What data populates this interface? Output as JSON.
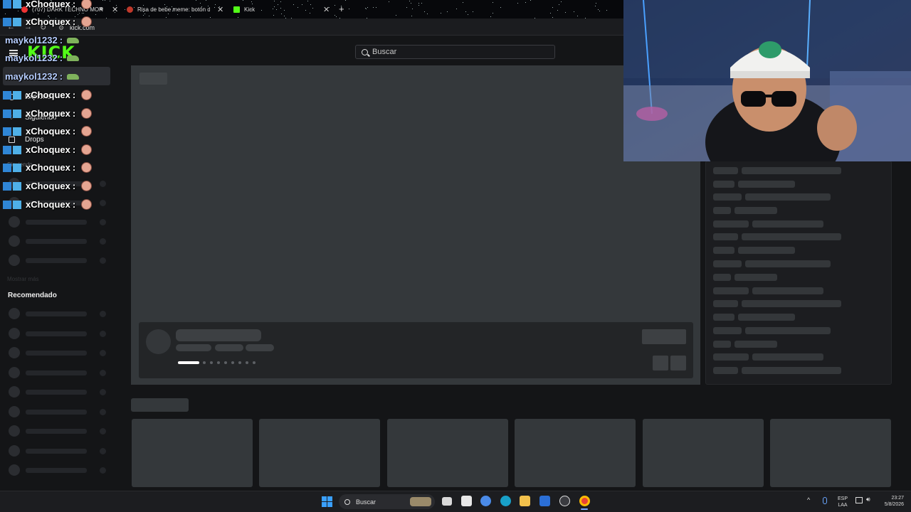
{
  "browser": {
    "tabs": [
      {
        "label": "(707) DARK TECHNO MORA",
        "active": false
      },
      {
        "label": "Risa de bebe meme: botón de",
        "active": false
      },
      {
        "label": "Kick",
        "active": true
      }
    ],
    "new_tab_symbol": "+",
    "close_symbol": "✕",
    "url": "kick.com"
  },
  "kick": {
    "logo_text": "KICK",
    "search_placeholder": "Buscar",
    "brand_color": "#53fc18",
    "sidebar": {
      "nav": [
        {
          "label": "Explorar",
          "icon": "compass-icon"
        },
        {
          "label": "Siguiendo",
          "icon": "heart-icon"
        },
        {
          "label": "Drops",
          "icon": "gift-icon"
        }
      ],
      "following_heading": "Siguiendo",
      "show_more": "Mostrar más",
      "recommended_heading": "Recomendado"
    }
  },
  "stream_overlay": {
    "chat_lines": [
      {
        "user": "xChoquex",
        "sep": ":",
        "emote": "head-emote"
      },
      {
        "user": "xChoquex",
        "sep": ":",
        "emote": "head-emote"
      },
      {
        "user": "maykol1232",
        "sep": ":",
        "emote": "croc-emote"
      },
      {
        "user": "maykol1232",
        "sep": ":",
        "emote": "croc-emote"
      },
      {
        "user": "maykol1232",
        "sep": ":",
        "emote": "croc-emote"
      },
      {
        "user": "xChoquex",
        "sep": ":",
        "emote": "head-emote"
      },
      {
        "user": "xChoquex",
        "sep": ":",
        "emote": "head-emote"
      },
      {
        "user": "xChoquex",
        "sep": ":",
        "emote": "head-emote"
      },
      {
        "user": "xChoquex",
        "sep": ":",
        "emote": "head-emote"
      },
      {
        "user": "xChoquex",
        "sep": ":",
        "emote": "head-emote"
      },
      {
        "user": "xChoquex",
        "sep": ":",
        "emote": "head-emote"
      },
      {
        "user": "xChoquex",
        "sep": ":",
        "emote": "head-emote"
      }
    ]
  },
  "taskbar": {
    "search_placeholder": "Buscar",
    "lang_top": "ESP",
    "lang_bottom": "LAA",
    "time": "23:27",
    "date": "5/8/2026"
  }
}
